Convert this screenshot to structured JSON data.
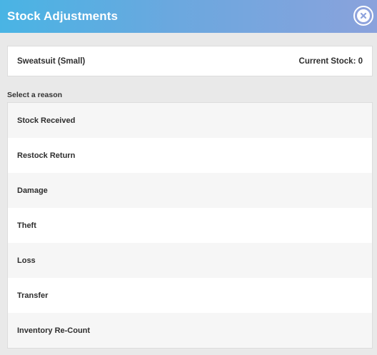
{
  "header": {
    "title": "Stock Adjustments",
    "close_icon": "close-icon"
  },
  "product": {
    "name": "Sweatsuit (Small)",
    "current_stock_label": "Current Stock: 0"
  },
  "reasons": {
    "label": "Select a reason",
    "items": [
      {
        "label": "Stock Received"
      },
      {
        "label": "Restock Return"
      },
      {
        "label": "Damage"
      },
      {
        "label": "Theft"
      },
      {
        "label": "Loss"
      },
      {
        "label": "Transfer"
      },
      {
        "label": "Inventory Re-Count"
      }
    ]
  },
  "colors": {
    "header_gradient_start": "#49b4e4",
    "header_gradient_end": "#8aa2dc",
    "background": "#e9e9e9",
    "row_alt": "#f6f6f6"
  }
}
